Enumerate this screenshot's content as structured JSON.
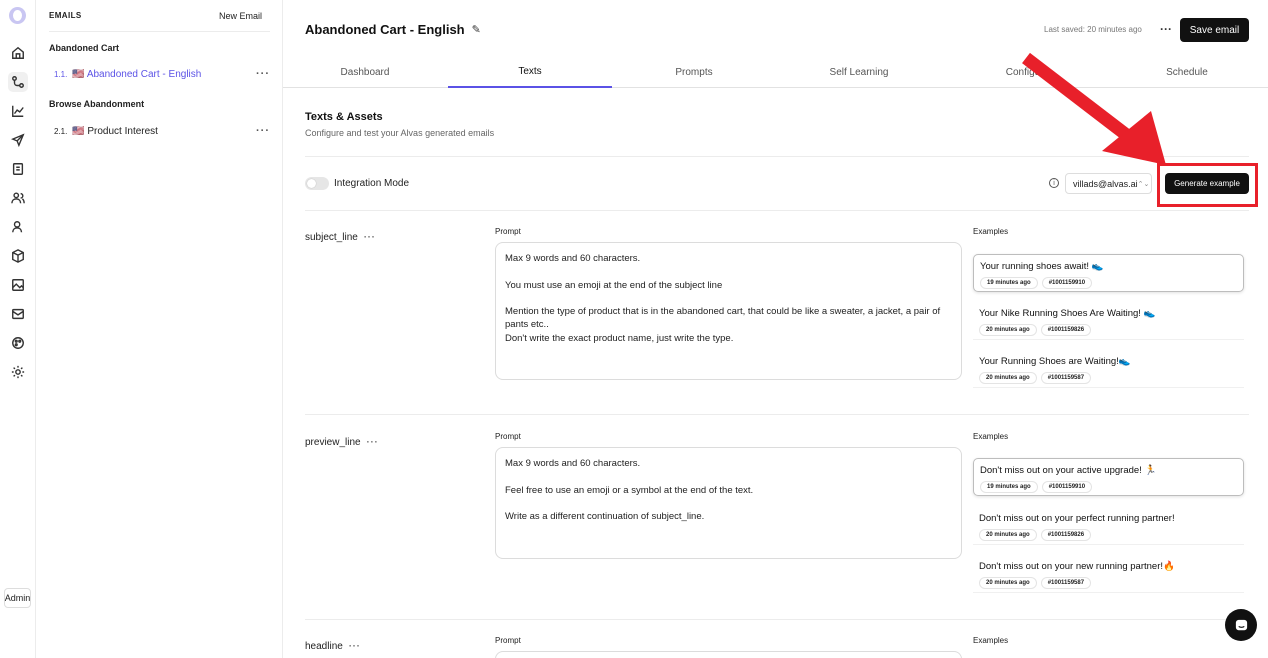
{
  "rail": {
    "icons": [
      "logo-icon",
      "home-icon",
      "flows-icon",
      "analytics-icon",
      "send-icon",
      "template-icon",
      "users-icon",
      "audience-icon",
      "products-icon",
      "gallery-icon",
      "inbox-icon",
      "palette-icon",
      "settings-icon"
    ],
    "admin_label": "Admin"
  },
  "sidebar": {
    "heading": "EMAILS",
    "new_email": "New Email",
    "groups": [
      {
        "title": "Abandoned Cart",
        "items": [
          {
            "num": "1.1.",
            "flag": "🇺🇸",
            "label": "Abandoned Cart - English",
            "active": true
          }
        ]
      },
      {
        "title": "Browse Abandonment",
        "items": [
          {
            "num": "2.1.",
            "flag": "🇺🇸",
            "label": "Product Interest",
            "active": false
          }
        ]
      }
    ]
  },
  "header": {
    "title": "Abandoned Cart - English",
    "last_saved": "Last saved: 20 minutes ago",
    "save_label": "Save email"
  },
  "tabs": [
    "Dashboard",
    "Texts",
    "Prompts",
    "Self Learning",
    "Configu",
    "Schedule"
  ],
  "active_tab": "Texts",
  "section": {
    "title": "Texts & Assets",
    "subtitle": "Configure and test your Alvas generated emails"
  },
  "toolbar": {
    "integration_label": "Integration Mode",
    "info_glyph": "i",
    "account": "villads@alvas.ai",
    "generate_label": "Generate example"
  },
  "labels": {
    "prompt": "Prompt",
    "examples": "Examples"
  },
  "fields": [
    {
      "name": "subject_line",
      "prompt_lines": [
        "Max 9 words and 60 characters.",
        "",
        "You must use an emoji at the end of the subject line",
        "",
        "Mention the type of product that is in the abandoned cart, that could be like a sweater, a jacket, a pair of pants etc..",
        "Don't write the exact product name, just write the type."
      ],
      "examples": [
        {
          "text": "Your running shoes await! 👟",
          "time": "19 minutes ago",
          "id": "#1001159910"
        },
        {
          "text": "Your Nike Running Shoes Are Waiting! 👟",
          "time": "20 minutes ago",
          "id": "#1001159826"
        },
        {
          "text": "Your Running Shoes are Waiting!👟",
          "time": "20 minutes ago",
          "id": "#1001159587"
        }
      ]
    },
    {
      "name": "preview_line",
      "prompt_lines": [
        "Max 9 words and 60 characters.",
        "",
        "Feel free to use an emoji or a symbol at the end of the text.",
        "",
        "Write as a different continuation of subject_line."
      ],
      "examples": [
        {
          "text": "Don't miss out on your active upgrade! 🏃",
          "time": "19 minutes ago",
          "id": "#1001159910"
        },
        {
          "text": "Don't miss out on your perfect running partner!",
          "time": "20 minutes ago",
          "id": "#1001159826"
        },
        {
          "text": "Don't miss out on your new running partner!🔥",
          "time": "20 minutes ago",
          "id": "#1001159587"
        }
      ]
    },
    {
      "name": "headline"
    }
  ],
  "colors": {
    "accent": "#5b52e6",
    "highlight": "#e8202a",
    "dark": "#111111"
  }
}
